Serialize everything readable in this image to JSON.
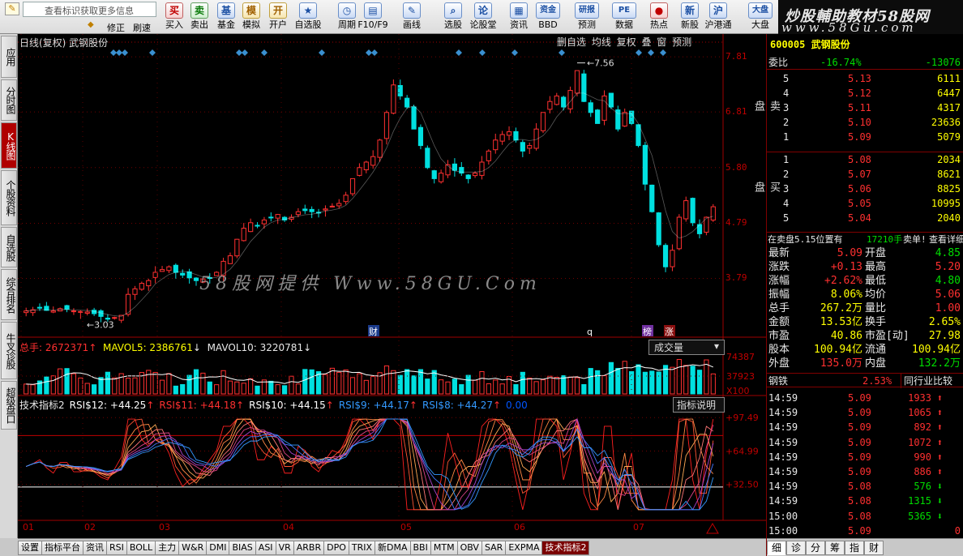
{
  "toolbar": {
    "search_placeholder": "查看标识获取更多信息",
    "row2_left": [
      "修正",
      "刷速"
    ],
    "buttons": [
      {
        "name": "buy-button",
        "icon": "买",
        "label": "买入",
        "style": "red"
      },
      {
        "name": "sell-button",
        "icon": "卖",
        "label": "卖出",
        "style": "green"
      },
      {
        "name": "fund-button",
        "icon": "基",
        "label": "基金",
        "style": ""
      },
      {
        "name": "simulate-button",
        "icon": "模",
        "label": "模拟",
        "style": "yel"
      },
      {
        "name": "open-account-button",
        "icon": "开",
        "label": "开户",
        "style": "yel"
      },
      {
        "name": "watchlist-button",
        "icon": "★",
        "label": "自选股",
        "style": ""
      },
      {
        "name": "period-button",
        "icon": "◷",
        "label": "周期",
        "style": ""
      },
      {
        "name": "f10-button",
        "icon": "▤",
        "label": "F10/F9",
        "style": ""
      },
      {
        "name": "draw-line-button",
        "icon": "✎",
        "label": "画线",
        "style": ""
      },
      {
        "name": "select-stock-button",
        "icon": "⌕",
        "label": "选股",
        "style": ""
      },
      {
        "name": "forum-button",
        "icon": "论",
        "label": "论股堂",
        "style": ""
      },
      {
        "name": "news-button",
        "icon": "▦",
        "label": "资讯",
        "style": ""
      },
      {
        "name": "funds-bbd-button",
        "icon": "资金",
        "label": "BBD",
        "style": ""
      },
      {
        "name": "research-button",
        "icon": "研报",
        "label": "预测",
        "style": ""
      },
      {
        "name": "data-button",
        "icon": "PE",
        "label": "数据",
        "style": ""
      },
      {
        "name": "hotspot-button",
        "icon": "●",
        "label": "热点",
        "style": "red"
      },
      {
        "name": "new-stock-button",
        "icon": "新",
        "label": "新股",
        "style": ""
      },
      {
        "name": "hk-connect-button",
        "icon": "沪",
        "label": "沪港通",
        "style": ""
      },
      {
        "name": "market-button",
        "icon": "大盘",
        "label": "大盘",
        "style": ""
      }
    ]
  },
  "brand": {
    "line1": "炒股輔助教材58股网",
    "line2": "www.58Gu.com"
  },
  "left_rail": [
    {
      "name": "rail-app",
      "label": "应用",
      "active": false
    },
    {
      "name": "rail-timeshare",
      "label": "分时图",
      "active": false
    },
    {
      "name": "rail-kline",
      "label": "K线图",
      "active": true
    },
    {
      "name": "rail-profile",
      "label": "个股资料",
      "active": false
    },
    {
      "name": "rail-selfpick",
      "label": "自选股",
      "active": false
    },
    {
      "name": "rail-rank",
      "label": "综合排名",
      "active": false
    },
    {
      "name": "rail-niucha",
      "label": "牛叉诊股",
      "active": false
    },
    {
      "name": "rail-superlevel",
      "label": "超级盘口",
      "active": false
    }
  ],
  "chart": {
    "title": "日线(复权) 武钢股份",
    "top_buttons": "删自选 均线 复权 叠 窗 预测",
    "watermark": "58股网提供 Www.58GU.Com",
    "price_axis": [
      "7.81",
      "6.81",
      "5.80",
      "4.79",
      "3.79"
    ],
    "high_mark": "7.56",
    "low_mark": "3.03",
    "markers": [
      "财",
      "q",
      "榜",
      "涨"
    ],
    "vol_legend": {
      "total": "总手: 2672371",
      "ma5": "MAVOL5: 2386761",
      "ma10": "MAVOL10: 3220781"
    },
    "vol_select": "成交量",
    "vol_axis": [
      "74387",
      "37923",
      "X100"
    ],
    "rsi_legend": {
      "name": "技术指标2",
      "items": [
        "RSI$12: +44.25",
        "RSI$11: +44.18",
        "RSI$10: +44.15",
        "RSI$9: +44.17",
        "RSI$8: +44.27",
        "0.00"
      ]
    },
    "rsi_help": "指标说明",
    "rsi_axis": [
      "+97.49",
      "+64.99",
      "+32.50"
    ],
    "months": [
      "01",
      "02",
      "03",
      "04",
      "05",
      "06",
      "07"
    ]
  },
  "chart_data": {
    "type": "candlestick",
    "title": "日线(复权) 武钢股份",
    "ylim": [
      2.9,
      7.9
    ],
    "x_months": [
      "01",
      "02",
      "03",
      "04",
      "05",
      "06",
      "07"
    ],
    "candles_close_approx": [
      3.2,
      3.22,
      3.25,
      3.21,
      3.2,
      3.24,
      3.23,
      3.2,
      3.19,
      3.18,
      3.15,
      3.1,
      3.05,
      3.08,
      3.12,
      3.5,
      3.6,
      3.7,
      3.75,
      3.9,
      3.95,
      4.0,
      3.9,
      3.85,
      3.8,
      3.75,
      3.78,
      3.8,
      3.9,
      4.1,
      4.2,
      4.5,
      4.7,
      4.8,
      4.75,
      4.85,
      4.9,
      4.95,
      4.85,
      4.9,
      5.0,
      5.02,
      5.0,
      4.98,
      5.05,
      5.1,
      5.15,
      5.3,
      5.6,
      5.8,
      5.9,
      6.0,
      6.3,
      6.8,
      7.3,
      7.1,
      6.9,
      6.5,
      6.2,
      5.8,
      5.6,
      5.7,
      5.85,
      5.75,
      5.7,
      5.6,
      5.7,
      5.9,
      6.1,
      6.3,
      6.4,
      6.45,
      6.3,
      6.1,
      6.2,
      6.5,
      6.8,
      7.0,
      7.1,
      6.9,
      7.2,
      7.56,
      7.0,
      6.8,
      6.6,
      7.1,
      6.9,
      6.5,
      6.8,
      6.6,
      6.2,
      5.5,
      5.0,
      4.4,
      4.0,
      4.3,
      4.9,
      5.2,
      4.8,
      4.6,
      4.9,
      5.09
    ],
    "volume_axis": [
      74387,
      37923
    ],
    "rsi_axis": [
      97.49,
      64.99,
      32.5
    ]
  },
  "quote": {
    "title": "600005 武钢股份",
    "weibi": {
      "label": "委比",
      "pct": "-16.74%",
      "val": "-13076"
    },
    "sell_label": "卖盘",
    "buy_label": "买盘",
    "sells": [
      [
        "5",
        "5.13",
        "6111"
      ],
      [
        "4",
        "5.12",
        "6447"
      ],
      [
        "3",
        "5.11",
        "4317"
      ],
      [
        "2",
        "5.10",
        "23636"
      ],
      [
        "1",
        "5.09",
        "5079"
      ]
    ],
    "buys": [
      [
        "1",
        "5.08",
        "2034"
      ],
      [
        "2",
        "5.07",
        "8621"
      ],
      [
        "3",
        "5.06",
        "8825"
      ],
      [
        "4",
        "5.05",
        "10995"
      ],
      [
        "5",
        "5.04",
        "2040"
      ]
    ],
    "notice": {
      "a": "在卖盘5.15位置有",
      "b": "17210手",
      "c": "卖单!",
      "d": "查看详细"
    },
    "stats": [
      [
        "最新",
        "5.09",
        "red",
        "开盘",
        "4.85",
        "grn"
      ],
      [
        "涨跌",
        "+0.13",
        "red",
        "最高",
        "5.20",
        "red"
      ],
      [
        "涨幅",
        "+2.62%",
        "red",
        "最低",
        "4.80",
        "grn"
      ],
      [
        "振幅",
        "8.06%",
        "yel",
        "均价",
        "5.06",
        "red"
      ],
      [
        "总手",
        "267.2万",
        "yel",
        "量比",
        "1.00",
        "red"
      ],
      [
        "金额",
        "13.53亿",
        "yel",
        "换手",
        "2.65%",
        "yel"
      ],
      [
        "市盈",
        "40.86",
        "yel",
        "市盈[动]",
        "27.98",
        "yel"
      ],
      [
        "股本",
        "100.94亿",
        "yel",
        "流通",
        "100.94亿",
        "yel"
      ],
      [
        "外盘",
        "135.0万",
        "red",
        "内盘",
        "132.2万",
        "grn"
      ]
    ],
    "sector": {
      "name": "钢铁",
      "pct": "2.53%",
      "compare": "同行业比较"
    },
    "ticks": [
      [
        "14:59",
        "5.09",
        "1933",
        "up"
      ],
      [
        "14:59",
        "5.09",
        "1065",
        "up"
      ],
      [
        "14:59",
        "5.09",
        "892",
        "up"
      ],
      [
        "14:59",
        "5.09",
        "1072",
        "up"
      ],
      [
        "14:59",
        "5.09",
        "990",
        "up"
      ],
      [
        "14:59",
        "5.09",
        "886",
        "up"
      ],
      [
        "14:59",
        "5.08",
        "576",
        "down"
      ],
      [
        "14:59",
        "5.08",
        "1315",
        "down"
      ],
      [
        "15:00",
        "5.08",
        "5365",
        "down"
      ],
      [
        "15:00",
        "5.09",
        "0",
        ""
      ]
    ],
    "tabs": [
      "细",
      "诊",
      "分",
      "筹",
      "指",
      "财"
    ]
  },
  "bottom_tabs": [
    "设置",
    "指标平台",
    "资讯",
    "RSI",
    "BOLL",
    "主力",
    "W&R",
    "DMI",
    "BIAS",
    "ASI",
    "VR",
    "ARBR",
    "DPO",
    "TRIX",
    "新DMA",
    "BBI",
    "MTM",
    "OBV",
    "SAR",
    "EXPMA",
    "技术指标2"
  ],
  "colors": {
    "up": "#ff3030",
    "down": "#00e0e0",
    "bg": "#000000",
    "axis": "#800000"
  }
}
